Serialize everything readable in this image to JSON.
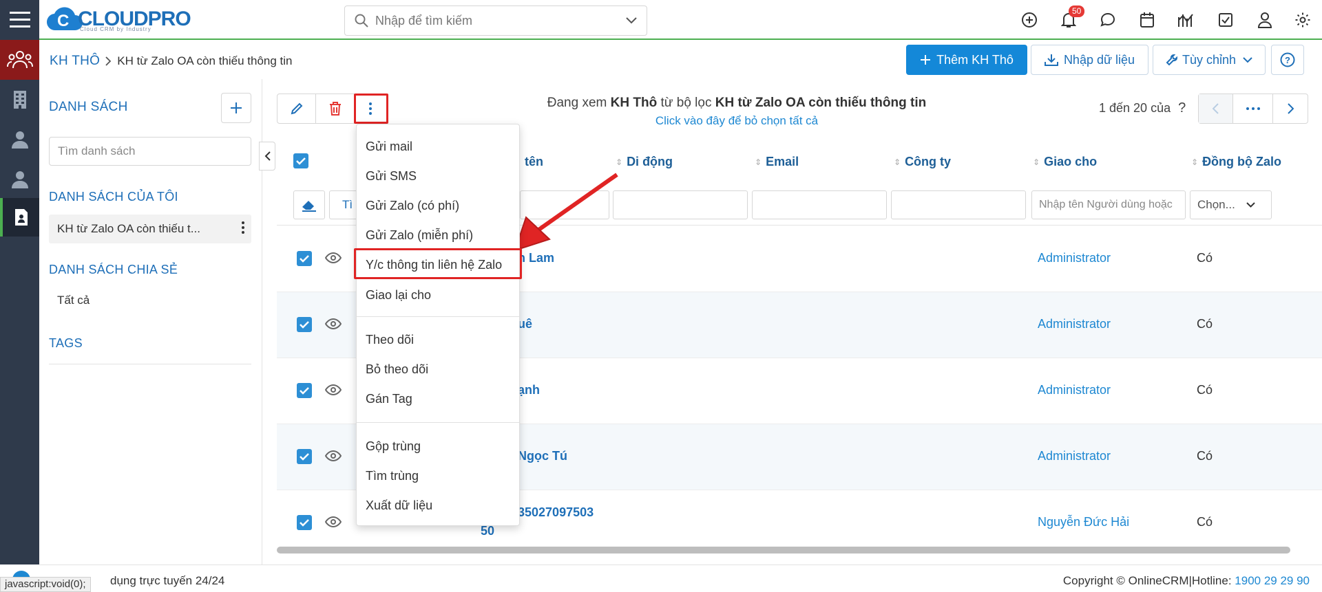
{
  "brand": {
    "logo_text": "CLOUDPRO",
    "logo_tagline": "Cloud CRM by Industry"
  },
  "colors": {
    "accent": "#1488d8",
    "rail": "#2f3a4b",
    "rail_active": "#8b1a1a",
    "highlight": "#e02424"
  },
  "search": {
    "placeholder": "Nhập để tìm kiếm"
  },
  "notifications": {
    "count": "50"
  },
  "breadcrumb": {
    "root": "KH THÔ",
    "current": "KH từ Zalo OA còn thiếu thông tin"
  },
  "header_actions": {
    "add": "Thêm KH Thô",
    "import": "Nhập dữ liệu",
    "customize": "Tùy chỉnh"
  },
  "sidebar": {
    "list_heading": "DANH SÁCH",
    "search_placeholder": "Tìm danh sách",
    "my_lists_heading": "DANH SÁCH CỦA TÔI",
    "my_list_item": "KH từ Zalo OA còn thiếu t...",
    "shared_heading": "DANH SÁCH CHIA SẺ",
    "shared_item": "Tất cả",
    "tags_heading": "TAGS"
  },
  "list_header": {
    "viewing_prefix": "Đang xem",
    "viewing_module": "KH Thô",
    "viewing_mid": "từ bộ lọc",
    "viewing_filter": "KH từ Zalo OA còn thiếu thông tin",
    "click_clear": "Click vào đây để bỏ chọn tất cả",
    "page_info": "1 đến 20 của",
    "page_unknown": "?"
  },
  "columns": {
    "name": "tên",
    "mobile": "Di động",
    "email": "Email",
    "company": "Công ty",
    "assigned": "Giao cho",
    "zalo_sync": "Đồng bộ Zalo"
  },
  "filters": {
    "search_button_fragment": "Tì",
    "assigned_placeholder": "Nhập tên Người dùng hoặc",
    "zalo_select": "Chọn..."
  },
  "rows": [
    {
      "name": "n Lam",
      "assigned": "Administrator",
      "zalo": "Có"
    },
    {
      "name": "uê",
      "assigned": "Administrator",
      "zalo": "Có"
    },
    {
      "name": "ạnh",
      "assigned": "Administrator",
      "zalo": "Có"
    },
    {
      "name": "Ngọc Tú",
      "assigned": "Administrator",
      "zalo": "Có"
    },
    {
      "name": "35027097503",
      "name_line2": "50",
      "assigned": "Nguyễn Đức Hải",
      "zalo": "Có"
    }
  ],
  "menu": {
    "group1": [
      "Gửi mail",
      "Gửi SMS",
      "Gửi Zalo (có phí)",
      "Gửi Zalo (miễn phí)",
      "Y/c thông tin liên hệ Zalo",
      "Giao lại cho"
    ],
    "group2": [
      "Theo dõi",
      "Bỏ theo dõi",
      "Gán Tag"
    ],
    "group3": [
      "Gộp trùng",
      "Tìm trùng",
      "Xuất dữ liệu"
    ]
  },
  "footer": {
    "status_tip": "javascript:void(0);",
    "left_text": "dụng trực tuyến 24/24",
    "copyright": "Copyright © OnlineCRM",
    "hotline_label": "|Hotline:",
    "hotline": "1900 29 29 90"
  }
}
